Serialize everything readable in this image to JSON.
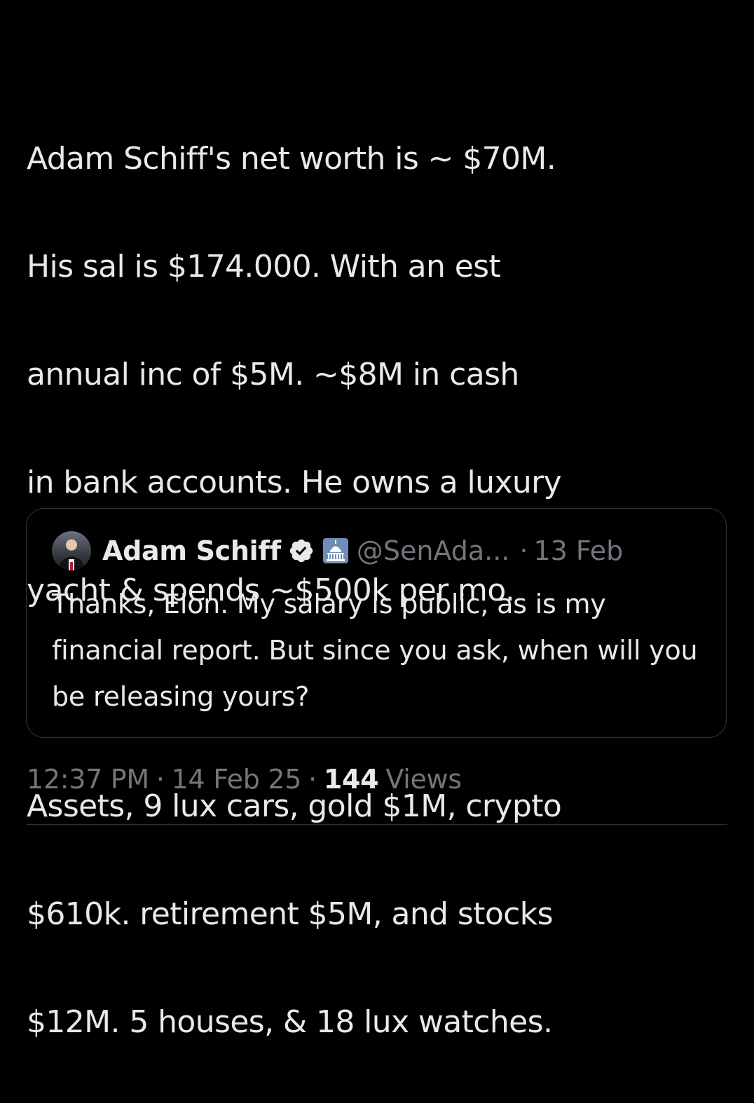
{
  "tweet": {
    "text_lines": [
      "Adam Schiff's net worth is  ~ $70M.",
      "His sal is $174.000. With an est",
      "annual inc of $5M.  ~$8M in cash",
      "in bank accounts. He owns a luxury",
      "yacht & spends ~$500k per mo."
    ],
    "text_lines_2": [
      "Assets,  9 lux cars, gold $1M, crypto",
      "$610k. retirement $5M, and stocks",
      "$12M.  5 houses, & 18 lux watches."
    ]
  },
  "quoted_tweet": {
    "author_name": "Adam Schiff",
    "handle": "@SenAda...",
    "separator": "·",
    "date": "13 Feb",
    "body": "Thanks, Elon. My salary is public, as is my financial report. But since you ask, when will you be releasing yours?",
    "verified_icon": "verified-badge-icon",
    "affiliation_icon": "us-capitol-icon"
  },
  "meta": {
    "time": "12:37 PM",
    "separator": "·",
    "date": "14 Feb 25",
    "views_count": "144",
    "views_label": "Views"
  },
  "colors": {
    "background": "#000000",
    "text": "#e7e9ea",
    "muted": "#71767b",
    "border": "#333639",
    "verified_blue": "#1d9bf0"
  }
}
